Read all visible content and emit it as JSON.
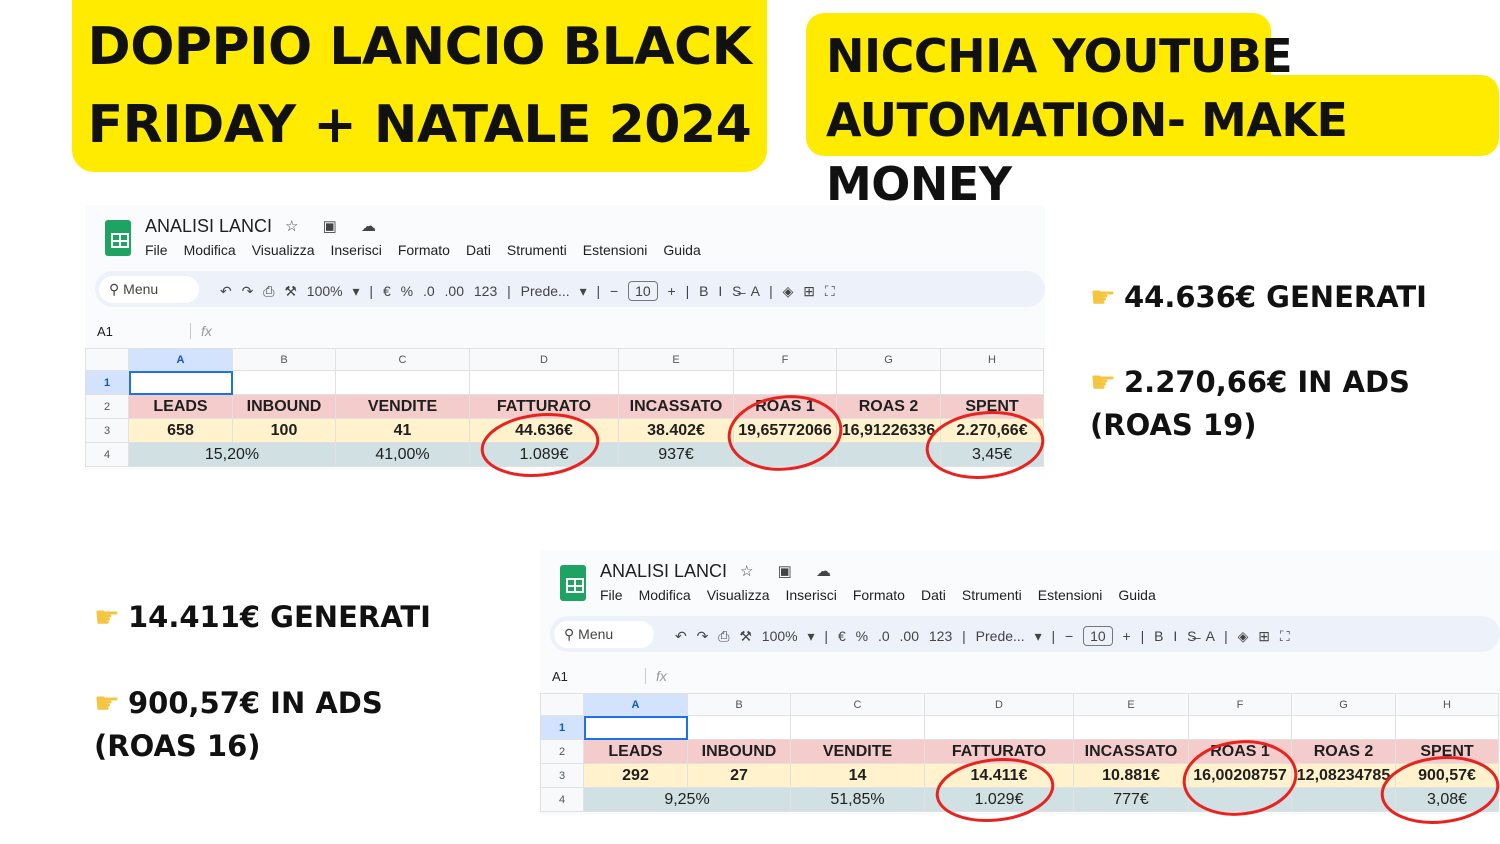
{
  "banners": {
    "left": [
      "DOPPIO LANCIO BLACK",
      "FRIDAY + NATALE 2024"
    ],
    "right": [
      "NICCHIA YOUTUBE",
      "AUTOMATION- MAKE MONEY"
    ]
  },
  "notes": {
    "top": [
      "44.636€ GENERATI",
      "2.270,66€ IN ADS (ROAS 19)"
    ],
    "bottom": [
      "14.411€ GENERATI",
      "900,57€ IN ADS (ROAS 16)"
    ],
    "icon": "pointing-hand-icon"
  },
  "sheet_common": {
    "title": "ANALISI LANCI",
    "menu": [
      "File",
      "Modifica",
      "Visualizza",
      "Inserisci",
      "Formato",
      "Dati",
      "Strumenti",
      "Estensioni",
      "Guida"
    ],
    "search": "Menu",
    "zoom": "100%",
    "font": "Prede...",
    "font_size": "10",
    "namebox": "A1",
    "fx": "fx",
    "columns": [
      "A",
      "B",
      "C",
      "D",
      "E",
      "F",
      "G",
      "H"
    ],
    "headers": [
      "LEADS",
      "INBOUND",
      "VENDITE",
      "FATTURATO",
      "INCASSATO",
      "ROAS 1",
      "ROAS 2",
      "SPENT"
    ],
    "highlight_color": "#e8231f"
  },
  "sheets": [
    {
      "row3": [
        "658",
        "100",
        "41",
        "44.636€",
        "38.402€",
        "19,65772066",
        "16,91226336",
        "2.270,66€"
      ],
      "row4": [
        "15,20%",
        "41,00%",
        "1.089€",
        "937€",
        "",
        "",
        "3,45€"
      ]
    },
    {
      "row3": [
        "292",
        "27",
        "14",
        "14.411€",
        "10.881€",
        "16,00208757",
        "12,08234785",
        "900,57€"
      ],
      "row4": [
        "9,25%",
        "51,85%",
        "1.029€",
        "777€",
        "",
        "",
        "3,08€"
      ]
    }
  ]
}
